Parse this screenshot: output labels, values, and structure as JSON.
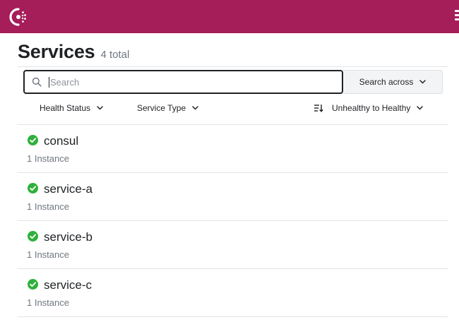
{
  "header": {
    "logo_icon": "consul-logo-icon",
    "menu_icon": "vertical-dots-icon",
    "bar_color": "#a51d59"
  },
  "page": {
    "title": "Services",
    "total": "4 total"
  },
  "search": {
    "placeholder": "Search",
    "value": "",
    "across_label": "Search across"
  },
  "filters": {
    "health_status": "Health Status",
    "service_type": "Service Type",
    "sort": "Unhealthy to Healthy"
  },
  "services": [
    {
      "name": "consul",
      "instances": "1 Instance",
      "status": "passing"
    },
    {
      "name": "service-a",
      "instances": "1 Instance",
      "status": "passing"
    },
    {
      "name": "service-b",
      "instances": "1 Instance",
      "status": "passing"
    },
    {
      "name": "service-c",
      "instances": "1 Instance",
      "status": "passing"
    }
  ],
  "colors": {
    "passing": "#2eb039"
  }
}
